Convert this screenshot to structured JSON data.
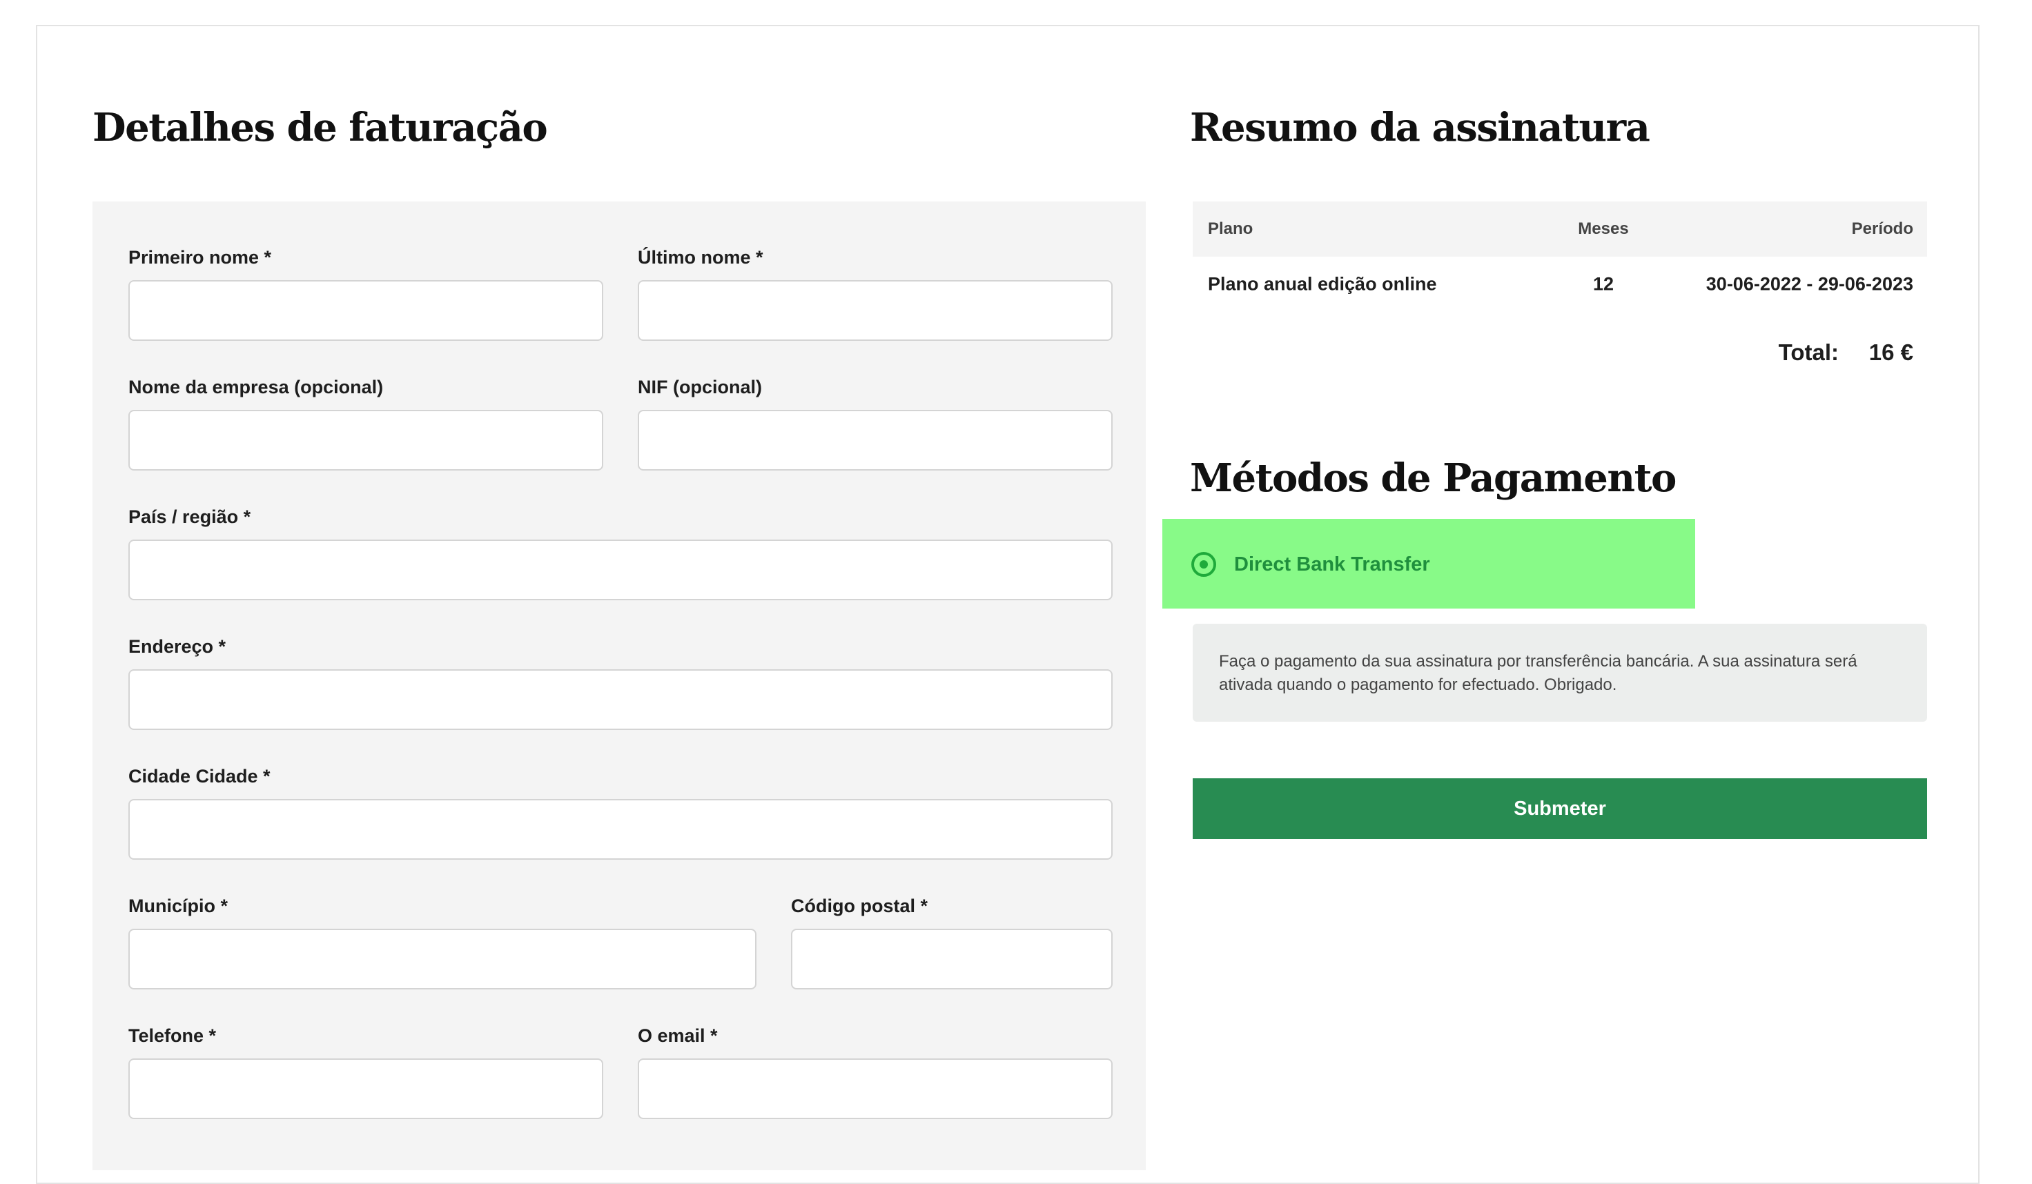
{
  "billing": {
    "title": "Detalhes de faturação",
    "fields": {
      "first_name": {
        "label": "Primeiro nome *",
        "value": "",
        "placeholder": ""
      },
      "last_name": {
        "label": "Último nome *",
        "value": "",
        "placeholder": ""
      },
      "company": {
        "label": "Nome da empresa (opcional)",
        "value": "",
        "placeholder": ""
      },
      "nif": {
        "label": "NIF (opcional)",
        "value": "",
        "placeholder": ""
      },
      "country": {
        "label": "País / região *",
        "value": "",
        "placeholder": ""
      },
      "address": {
        "label": "Endereço *",
        "value": "",
        "placeholder": ""
      },
      "city": {
        "label": "Cidade Cidade *",
        "value": "",
        "placeholder": ""
      },
      "municipality": {
        "label": "Município *",
        "value": "",
        "placeholder": ""
      },
      "postal_code": {
        "label": "Código postal *",
        "value": "",
        "placeholder": ""
      },
      "phone": {
        "label": "Telefone *",
        "value": "",
        "placeholder": ""
      },
      "email": {
        "label": "O email *",
        "value": "",
        "placeholder": ""
      }
    }
  },
  "summary": {
    "title": "Resumo da assinatura",
    "headers": {
      "plan": "Plano",
      "months": "Meses",
      "period": "Período"
    },
    "rows": [
      {
        "plan": "Plano anual edição online",
        "months": "12",
        "period": "30-06-2022 - 29-06-2023"
      }
    ],
    "total_label": "Total:",
    "total_value": "16 €"
  },
  "payment": {
    "title": "Métodos de Pagamento",
    "option_label": "Direct Bank Transfer",
    "selected": true,
    "highlight_color": "#88fa88",
    "description": "Faça o pagamento da sua assinatura por transferência bancária. A sua assinatura será ativada quando o pagamento for efectuado. Obrigado.",
    "submit_label": "Submeter",
    "submit_color": "#288c52"
  }
}
